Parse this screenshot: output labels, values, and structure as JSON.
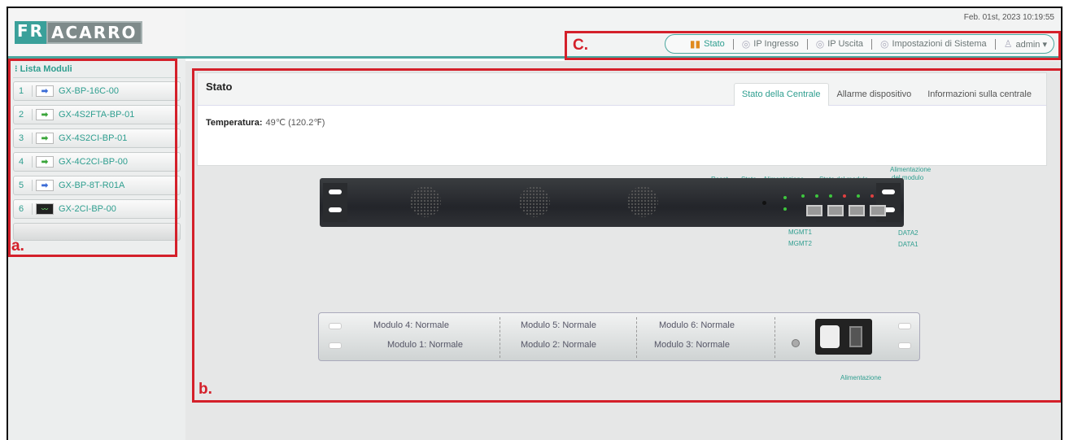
{
  "brand": {
    "logo_prefix": "FR",
    "logo_rest": "ACARRO",
    "accent": "#2e9e8f",
    "annotation_color": "#d4202a"
  },
  "header": {
    "datetime": "Feb. 01st, 2023 10:19:55",
    "nav": [
      {
        "label": "Stato",
        "icon": "bar-chart-icon"
      },
      {
        "label": "IP Ingresso",
        "icon": "circle-icon"
      },
      {
        "label": "IP Uscita",
        "icon": "circle-icon"
      },
      {
        "label": "Impostazioni di Sistema",
        "icon": "circle-icon"
      },
      {
        "label": "admin ▾",
        "icon": "user-icon"
      }
    ]
  },
  "sidebar": {
    "title": "Lista Moduli",
    "items": [
      {
        "num": "1",
        "label": "GX-BP-16C-00",
        "icon": "arrow-right-blue-icon"
      },
      {
        "num": "2",
        "label": "GX-4S2FTA-BP-01",
        "icon": "arrow-right-green-icon"
      },
      {
        "num": "3",
        "label": "GX-4S2CI-BP-01",
        "icon": "arrow-right-green-icon"
      },
      {
        "num": "4",
        "label": "GX-4C2CI-BP-00",
        "icon": "arrow-right-green-icon"
      },
      {
        "num": "5",
        "label": "GX-BP-8T-R01A",
        "icon": "arrow-right-blue-icon"
      },
      {
        "num": "6",
        "label": "GX-2CI-BP-00",
        "icon": "ci-module-icon"
      }
    ]
  },
  "main": {
    "title": "Stato",
    "tabs": [
      "Stato della Centrale",
      "Allarme dispositivo",
      "Informazioni sulla centrale"
    ],
    "temperature_label": "Temperatura:",
    "temperature_value": "49℃ (120.2℉)",
    "front_labels": {
      "reset": "Reset",
      "stato": "Stato",
      "alimentazione": "Alimentazione",
      "stato_modulo": "Stato del modulo",
      "alim_modulo_1": "Alimentazione",
      "alim_modulo_2": "del modulo",
      "mgmt1": "MGMT1",
      "mgmt2": "MGMT2",
      "data1": "DATA1",
      "data2": "DATA2"
    },
    "back_modules": [
      "Modulo 4: Normale",
      "Modulo 5: Normale",
      "Modulo 6: Normale",
      "Modulo 1: Normale",
      "Modulo 2: Normale",
      "Modulo 3: Normale"
    ],
    "power_label": "Alimentazione"
  },
  "annotations": {
    "a": "a.",
    "b": "b.",
    "c": "C."
  }
}
